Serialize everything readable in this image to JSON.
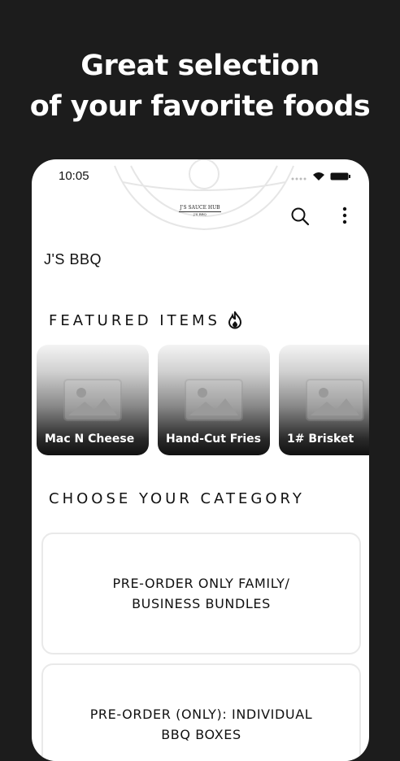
{
  "headline": {
    "line1": "Great selection",
    "line2": "of your favorite foods"
  },
  "status_bar": {
    "time": "10:05"
  },
  "header": {
    "logo_line1": "J'S SAUCE HUB",
    "logo_line2": "J'S BBQ"
  },
  "store": {
    "name": "J'S BBQ"
  },
  "featured": {
    "title": "FEATURED ITEMS",
    "items": [
      {
        "label": "Mac N Cheese"
      },
      {
        "label": "Hand-Cut Fries"
      },
      {
        "label": "1# Brisket"
      }
    ]
  },
  "categories": {
    "title": "CHOOSE YOUR CATEGORY",
    "items": [
      {
        "label": "PRE-ORDER ONLY FAMILY/\nBUSINESS BUNDLES"
      },
      {
        "label": "PRE-ORDER (ONLY): INDIVIDUAL\nBBQ BOXES"
      }
    ]
  },
  "icons": {
    "search": "search-icon",
    "more": "more-vertical-icon",
    "fire": "fire-icon",
    "wifi": "wifi-icon",
    "battery": "battery-icon",
    "placeholder": "image-placeholder-icon"
  }
}
